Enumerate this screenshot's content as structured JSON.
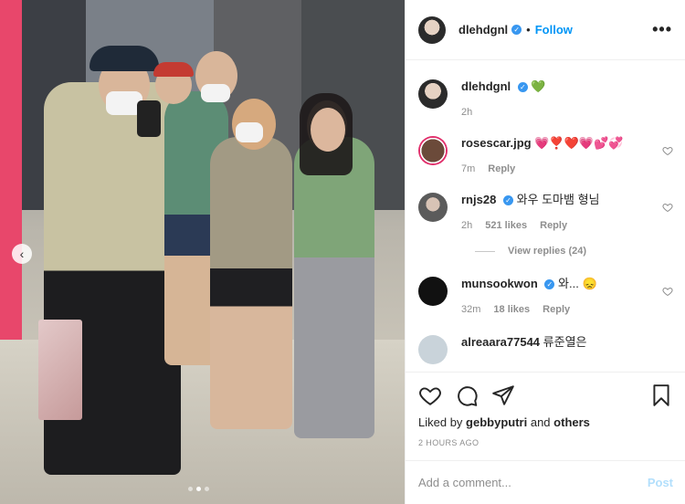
{
  "post": {
    "author": "dlehdgnl",
    "separator": "•",
    "follow_label": "Follow",
    "more_label": "•••",
    "nav_prev": "‹",
    "caption_emoji": "💚",
    "caption_time": "2h",
    "photo_page": 2,
    "photo_count": 3
  },
  "comments": [
    {
      "username": "rosescar.jpg",
      "text": "💗❣️❤️💗💕💞",
      "time": "7m",
      "likes": "",
      "reply_label": "Reply",
      "avatar_color": "#6b4a3a"
    },
    {
      "username": "rnjs28",
      "text": "와우 도마뱀 형님",
      "time": "2h",
      "likes": "521 likes",
      "reply_label": "Reply",
      "avatar_color": "#5b5b5b"
    },
    {
      "username": "munsookwon",
      "text": "와... 😞",
      "time": "32m",
      "likes": "18 likes",
      "reply_label": "Reply",
      "avatar_color": "#111111"
    },
    {
      "username": "alreaara77544",
      "text": "류준열은",
      "avatar_color": "#c9d3da"
    }
  ],
  "view_replies": "View replies (24)",
  "actions": {
    "liked_by_prefix": "Liked by",
    "liked_by_user": "gebbyputri",
    "and_label": "and",
    "others_label": "others",
    "timestamp": "2 HOURS AGO"
  },
  "add_comment": {
    "placeholder": "Add a comment...",
    "post_label": "Post"
  },
  "colors": {
    "accent": "#0095f6",
    "verified": "#3897f0",
    "post_disabled": "#b2dffc",
    "photo_pink_edge": "#e8476b"
  }
}
